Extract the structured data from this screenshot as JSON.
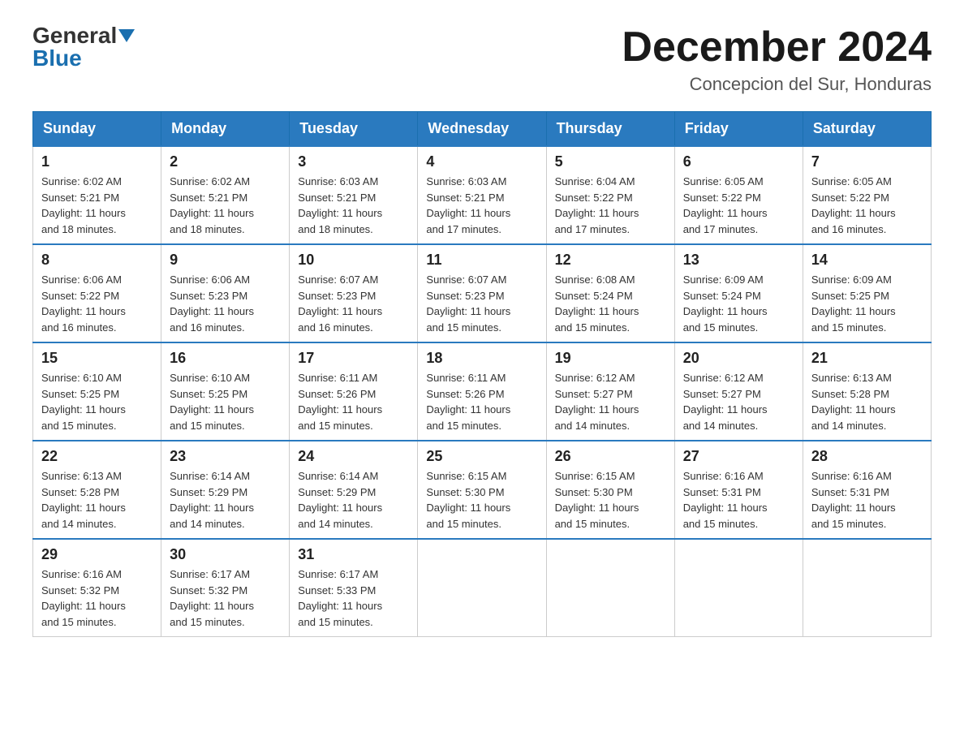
{
  "header": {
    "logo_general": "General",
    "logo_blue": "Blue",
    "month_title": "December 2024",
    "location": "Concepcion del Sur, Honduras"
  },
  "weekdays": [
    "Sunday",
    "Monday",
    "Tuesday",
    "Wednesday",
    "Thursday",
    "Friday",
    "Saturday"
  ],
  "weeks": [
    [
      {
        "day": "1",
        "sunrise": "6:02 AM",
        "sunset": "5:21 PM",
        "daylight": "11 hours and 18 minutes."
      },
      {
        "day": "2",
        "sunrise": "6:02 AM",
        "sunset": "5:21 PM",
        "daylight": "11 hours and 18 minutes."
      },
      {
        "day": "3",
        "sunrise": "6:03 AM",
        "sunset": "5:21 PM",
        "daylight": "11 hours and 18 minutes."
      },
      {
        "day": "4",
        "sunrise": "6:03 AM",
        "sunset": "5:21 PM",
        "daylight": "11 hours and 17 minutes."
      },
      {
        "day": "5",
        "sunrise": "6:04 AM",
        "sunset": "5:22 PM",
        "daylight": "11 hours and 17 minutes."
      },
      {
        "day": "6",
        "sunrise": "6:05 AM",
        "sunset": "5:22 PM",
        "daylight": "11 hours and 17 minutes."
      },
      {
        "day": "7",
        "sunrise": "6:05 AM",
        "sunset": "5:22 PM",
        "daylight": "11 hours and 16 minutes."
      }
    ],
    [
      {
        "day": "8",
        "sunrise": "6:06 AM",
        "sunset": "5:22 PM",
        "daylight": "11 hours and 16 minutes."
      },
      {
        "day": "9",
        "sunrise": "6:06 AM",
        "sunset": "5:23 PM",
        "daylight": "11 hours and 16 minutes."
      },
      {
        "day": "10",
        "sunrise": "6:07 AM",
        "sunset": "5:23 PM",
        "daylight": "11 hours and 16 minutes."
      },
      {
        "day": "11",
        "sunrise": "6:07 AM",
        "sunset": "5:23 PM",
        "daylight": "11 hours and 15 minutes."
      },
      {
        "day": "12",
        "sunrise": "6:08 AM",
        "sunset": "5:24 PM",
        "daylight": "11 hours and 15 minutes."
      },
      {
        "day": "13",
        "sunrise": "6:09 AM",
        "sunset": "5:24 PM",
        "daylight": "11 hours and 15 minutes."
      },
      {
        "day": "14",
        "sunrise": "6:09 AM",
        "sunset": "5:25 PM",
        "daylight": "11 hours and 15 minutes."
      }
    ],
    [
      {
        "day": "15",
        "sunrise": "6:10 AM",
        "sunset": "5:25 PM",
        "daylight": "11 hours and 15 minutes."
      },
      {
        "day": "16",
        "sunrise": "6:10 AM",
        "sunset": "5:25 PM",
        "daylight": "11 hours and 15 minutes."
      },
      {
        "day": "17",
        "sunrise": "6:11 AM",
        "sunset": "5:26 PM",
        "daylight": "11 hours and 15 minutes."
      },
      {
        "day": "18",
        "sunrise": "6:11 AM",
        "sunset": "5:26 PM",
        "daylight": "11 hours and 15 minutes."
      },
      {
        "day": "19",
        "sunrise": "6:12 AM",
        "sunset": "5:27 PM",
        "daylight": "11 hours and 14 minutes."
      },
      {
        "day": "20",
        "sunrise": "6:12 AM",
        "sunset": "5:27 PM",
        "daylight": "11 hours and 14 minutes."
      },
      {
        "day": "21",
        "sunrise": "6:13 AM",
        "sunset": "5:28 PM",
        "daylight": "11 hours and 14 minutes."
      }
    ],
    [
      {
        "day": "22",
        "sunrise": "6:13 AM",
        "sunset": "5:28 PM",
        "daylight": "11 hours and 14 minutes."
      },
      {
        "day": "23",
        "sunrise": "6:14 AM",
        "sunset": "5:29 PM",
        "daylight": "11 hours and 14 minutes."
      },
      {
        "day": "24",
        "sunrise": "6:14 AM",
        "sunset": "5:29 PM",
        "daylight": "11 hours and 14 minutes."
      },
      {
        "day": "25",
        "sunrise": "6:15 AM",
        "sunset": "5:30 PM",
        "daylight": "11 hours and 15 minutes."
      },
      {
        "day": "26",
        "sunrise": "6:15 AM",
        "sunset": "5:30 PM",
        "daylight": "11 hours and 15 minutes."
      },
      {
        "day": "27",
        "sunrise": "6:16 AM",
        "sunset": "5:31 PM",
        "daylight": "11 hours and 15 minutes."
      },
      {
        "day": "28",
        "sunrise": "6:16 AM",
        "sunset": "5:31 PM",
        "daylight": "11 hours and 15 minutes."
      }
    ],
    [
      {
        "day": "29",
        "sunrise": "6:16 AM",
        "sunset": "5:32 PM",
        "daylight": "11 hours and 15 minutes."
      },
      {
        "day": "30",
        "sunrise": "6:17 AM",
        "sunset": "5:32 PM",
        "daylight": "11 hours and 15 minutes."
      },
      {
        "day": "31",
        "sunrise": "6:17 AM",
        "sunset": "5:33 PM",
        "daylight": "11 hours and 15 minutes."
      },
      null,
      null,
      null,
      null
    ]
  ],
  "labels": {
    "sunrise": "Sunrise:",
    "sunset": "Sunset:",
    "daylight": "Daylight:"
  }
}
